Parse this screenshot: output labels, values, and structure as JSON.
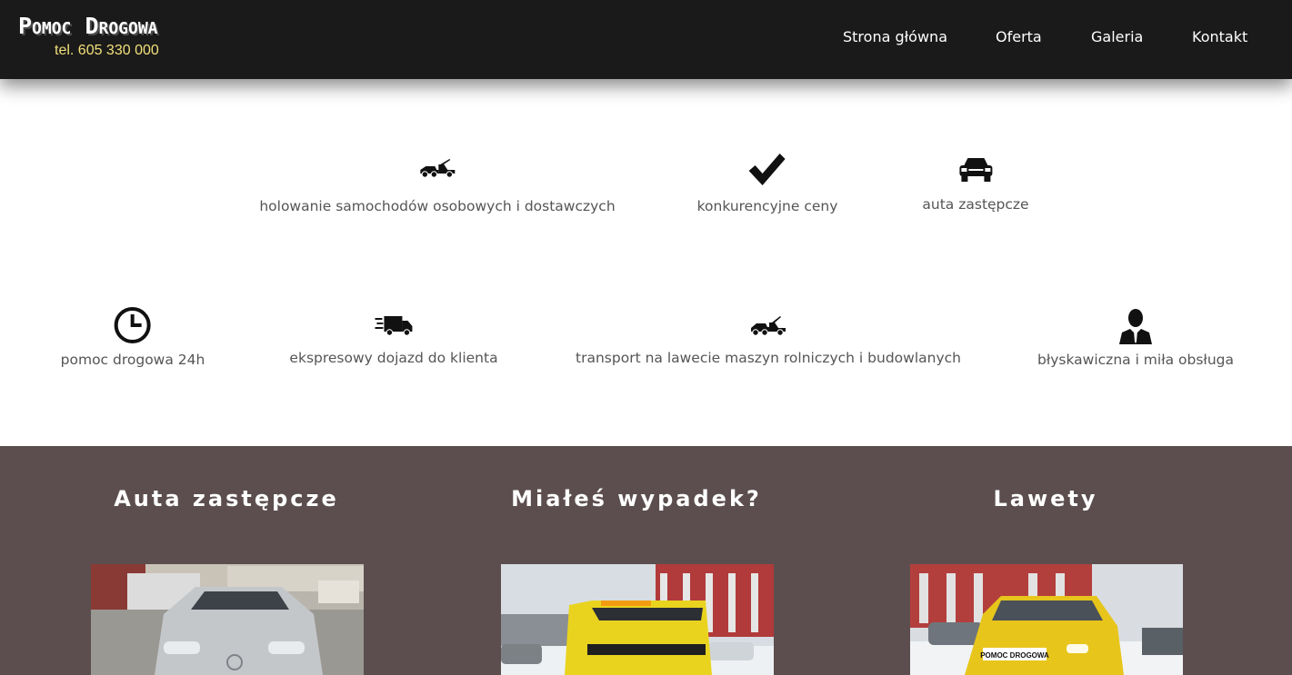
{
  "header": {
    "brand_name": "Pomoc Drogowa",
    "phone": "tel. 605 330 000",
    "nav": [
      {
        "label": "Strona główna"
      },
      {
        "label": "Oferta"
      },
      {
        "label": "Galeria"
      },
      {
        "label": "Kontakt"
      }
    ]
  },
  "features": [
    {
      "icon": "tow-truck-icon",
      "label": "holowanie samochodów osobowych i dostawczych"
    },
    {
      "icon": "checkmark-icon",
      "label": "konkurencyjne ceny"
    },
    {
      "icon": "car-icon",
      "label": "auta zastępcze"
    },
    {
      "icon": "clock-icon",
      "label": "pomoc drogowa 24h"
    },
    {
      "icon": "fast-van-icon",
      "label": "ekspresowy dojazd do klienta"
    },
    {
      "icon": "flatbed-truck-icon",
      "label": "transport na lawecie maszyn rolniczych i budowlanych"
    },
    {
      "icon": "person-icon",
      "label": "błyskawiczna i miła obsługa"
    }
  ],
  "sections": [
    {
      "title": "Auta zastępcze",
      "image": "replacement-car-photo"
    },
    {
      "title": "Miałeś wypadek?",
      "image": "tow-truck-photo"
    },
    {
      "title": "Lawety",
      "image": "flatbed-truck-photo"
    }
  ],
  "photo_text": {
    "truck_sign": "POMOC DROGOWA"
  },
  "colors": {
    "header_bg": "#1b1a1a",
    "phone": "#f0e07a",
    "band_bg": "#5c4e4f",
    "feature_text": "#555555"
  }
}
